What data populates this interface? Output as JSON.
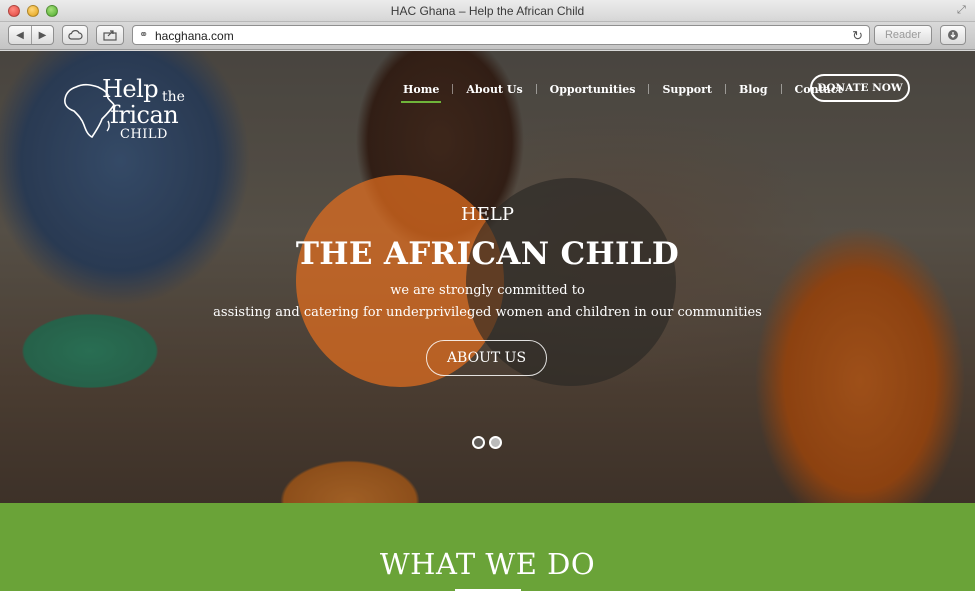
{
  "browser": {
    "window_title": "HAC Ghana – Help the African Child",
    "url": "hacghana.com",
    "reader_label": "Reader"
  },
  "logo": {
    "line1": "Help",
    "the": "the",
    "line2": "frican",
    "line3": "CHILD"
  },
  "nav": {
    "items": [
      {
        "label": "Home",
        "active": true
      },
      {
        "label": "About Us"
      },
      {
        "label": "Opportunities"
      },
      {
        "label": "Support"
      },
      {
        "label": "Blog"
      },
      {
        "label": "Contact"
      }
    ],
    "donate_label": "DONATE NOW"
  },
  "hero": {
    "kicker": "HELP",
    "title": "THE AFRICAN CHILD",
    "subtitle_line1": "we are strongly committed to",
    "subtitle_line2": "assisting and catering for underprivileged women and children in our communities",
    "cta_label": "ABOUT US",
    "slide_count": 2,
    "active_slide": 2
  },
  "what_we_do": {
    "title": "WHAT WE DO"
  },
  "colors": {
    "accent_green": "#6aa338",
    "circle_orange": "#e26e1e",
    "circle_dark": "#282624"
  }
}
